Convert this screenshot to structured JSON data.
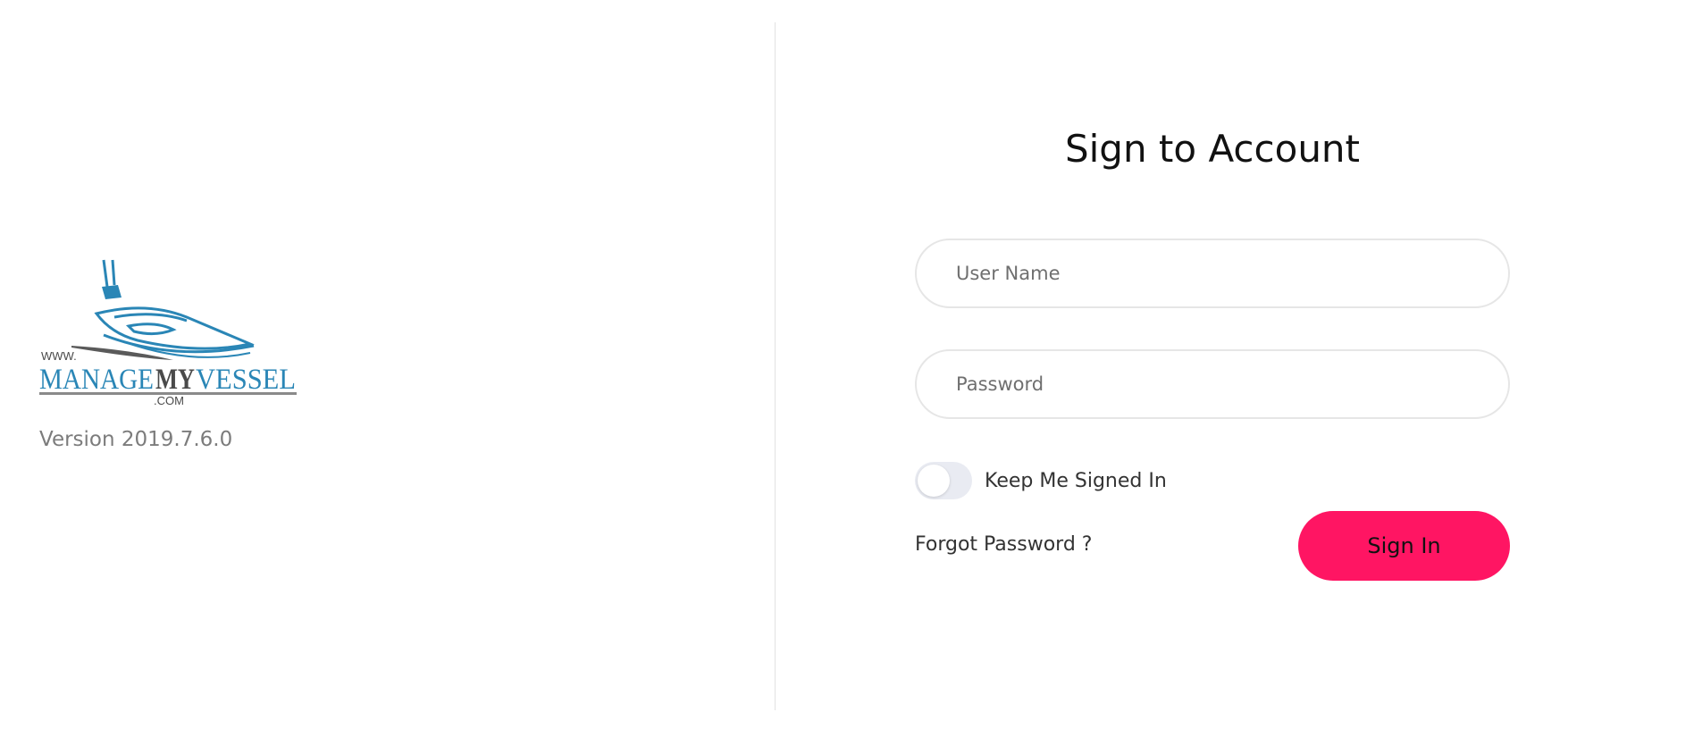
{
  "brand": {
    "logo_text_www": "WWW.",
    "logo_text_manage": "MANAGE",
    "logo_text_my": "MY",
    "logo_text_vessel": "VESSEL",
    "logo_text_com": ".COM",
    "version": "Version 2019.7.6.0",
    "colors": {
      "blue": "#2a86b6",
      "dark": "#4a4a4a"
    }
  },
  "form": {
    "title": "Sign to Account",
    "username_placeholder": "User Name",
    "username_value": "",
    "password_placeholder": "Password",
    "password_value": "",
    "keep_signed_in_label": "Keep Me Signed In",
    "keep_signed_in_checked": false,
    "forgot_password_label": "Forgot Password ?",
    "signin_label": "Sign In",
    "accent_color": "#ff1563"
  }
}
